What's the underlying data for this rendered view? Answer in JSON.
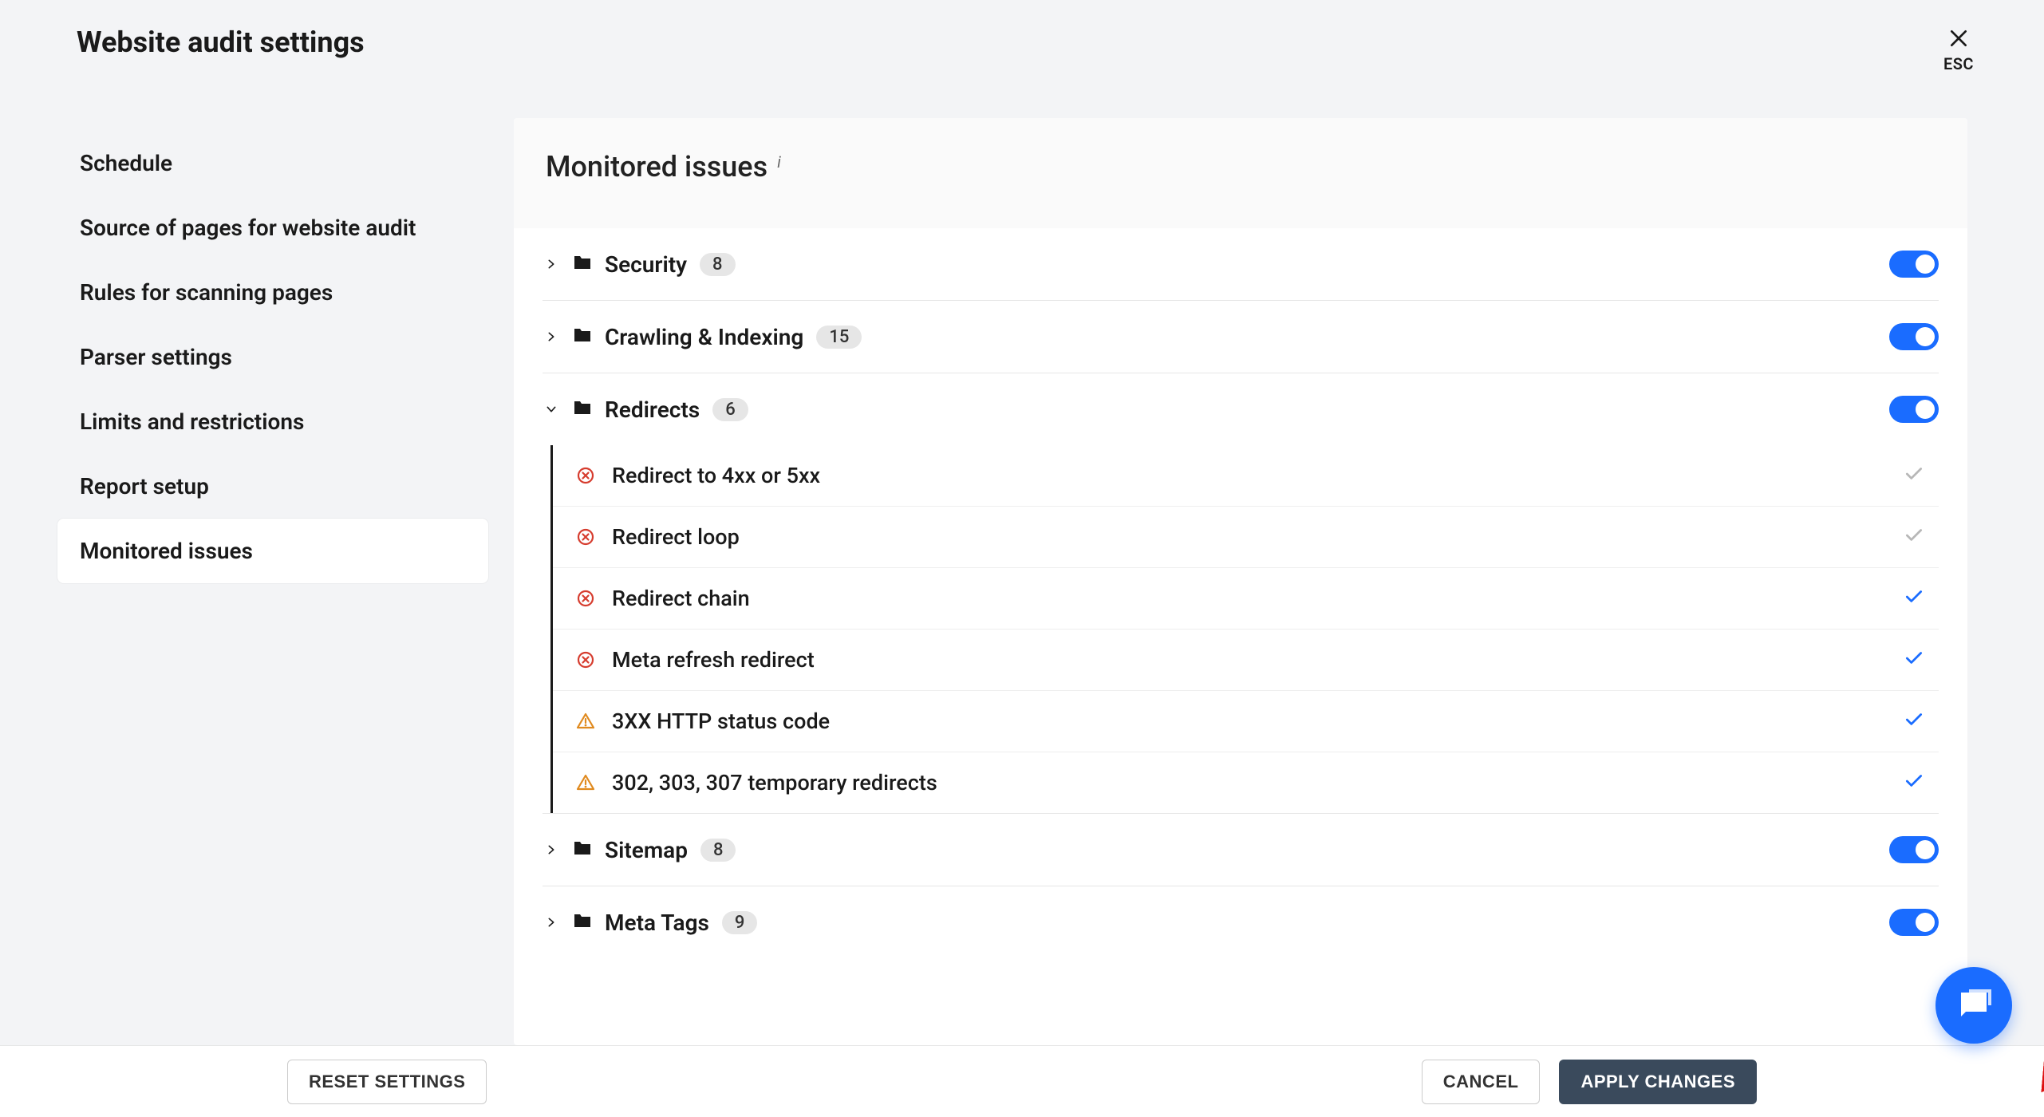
{
  "header": {
    "title": "Website audit settings",
    "esc_label": "ESC"
  },
  "sidebar": {
    "items": [
      {
        "label": "Schedule",
        "active": false
      },
      {
        "label": "Source of pages for website audit",
        "active": false
      },
      {
        "label": "Rules for scanning pages",
        "active": false
      },
      {
        "label": "Parser settings",
        "active": false
      },
      {
        "label": "Limits and restrictions",
        "active": false
      },
      {
        "label": "Report setup",
        "active": false
      },
      {
        "label": "Monitored issues",
        "active": true
      }
    ]
  },
  "panel": {
    "title": "Monitored issues",
    "categories": [
      {
        "name": "Security",
        "count": "8",
        "expanded": false,
        "toggled": true
      },
      {
        "name": "Crawling & Indexing",
        "count": "15",
        "expanded": false,
        "toggled": true
      },
      {
        "name": "Redirects",
        "count": "6",
        "expanded": true,
        "toggled": true,
        "issues": [
          {
            "severity": "error",
            "label": "Redirect to 4xx or 5xx",
            "checked": false
          },
          {
            "severity": "error",
            "label": "Redirect loop",
            "checked": false
          },
          {
            "severity": "error",
            "label": "Redirect chain",
            "checked": true
          },
          {
            "severity": "error",
            "label": "Meta refresh redirect",
            "checked": true
          },
          {
            "severity": "warning",
            "label": "3XX HTTP status code",
            "checked": true
          },
          {
            "severity": "warning",
            "label": "302, 303, 307 temporary redirects",
            "checked": true
          }
        ]
      },
      {
        "name": "Sitemap",
        "count": "8",
        "expanded": false,
        "toggled": true
      },
      {
        "name": "Meta Tags",
        "count": "9",
        "expanded": false,
        "toggled": true
      }
    ]
  },
  "footer": {
    "reset_label": "RESET SETTINGS",
    "cancel_label": "CANCEL",
    "apply_label": "APPLY CHANGES"
  },
  "colors": {
    "accent": "#1a6cff",
    "error": "#d63c2e",
    "warning": "#e08a1f"
  }
}
